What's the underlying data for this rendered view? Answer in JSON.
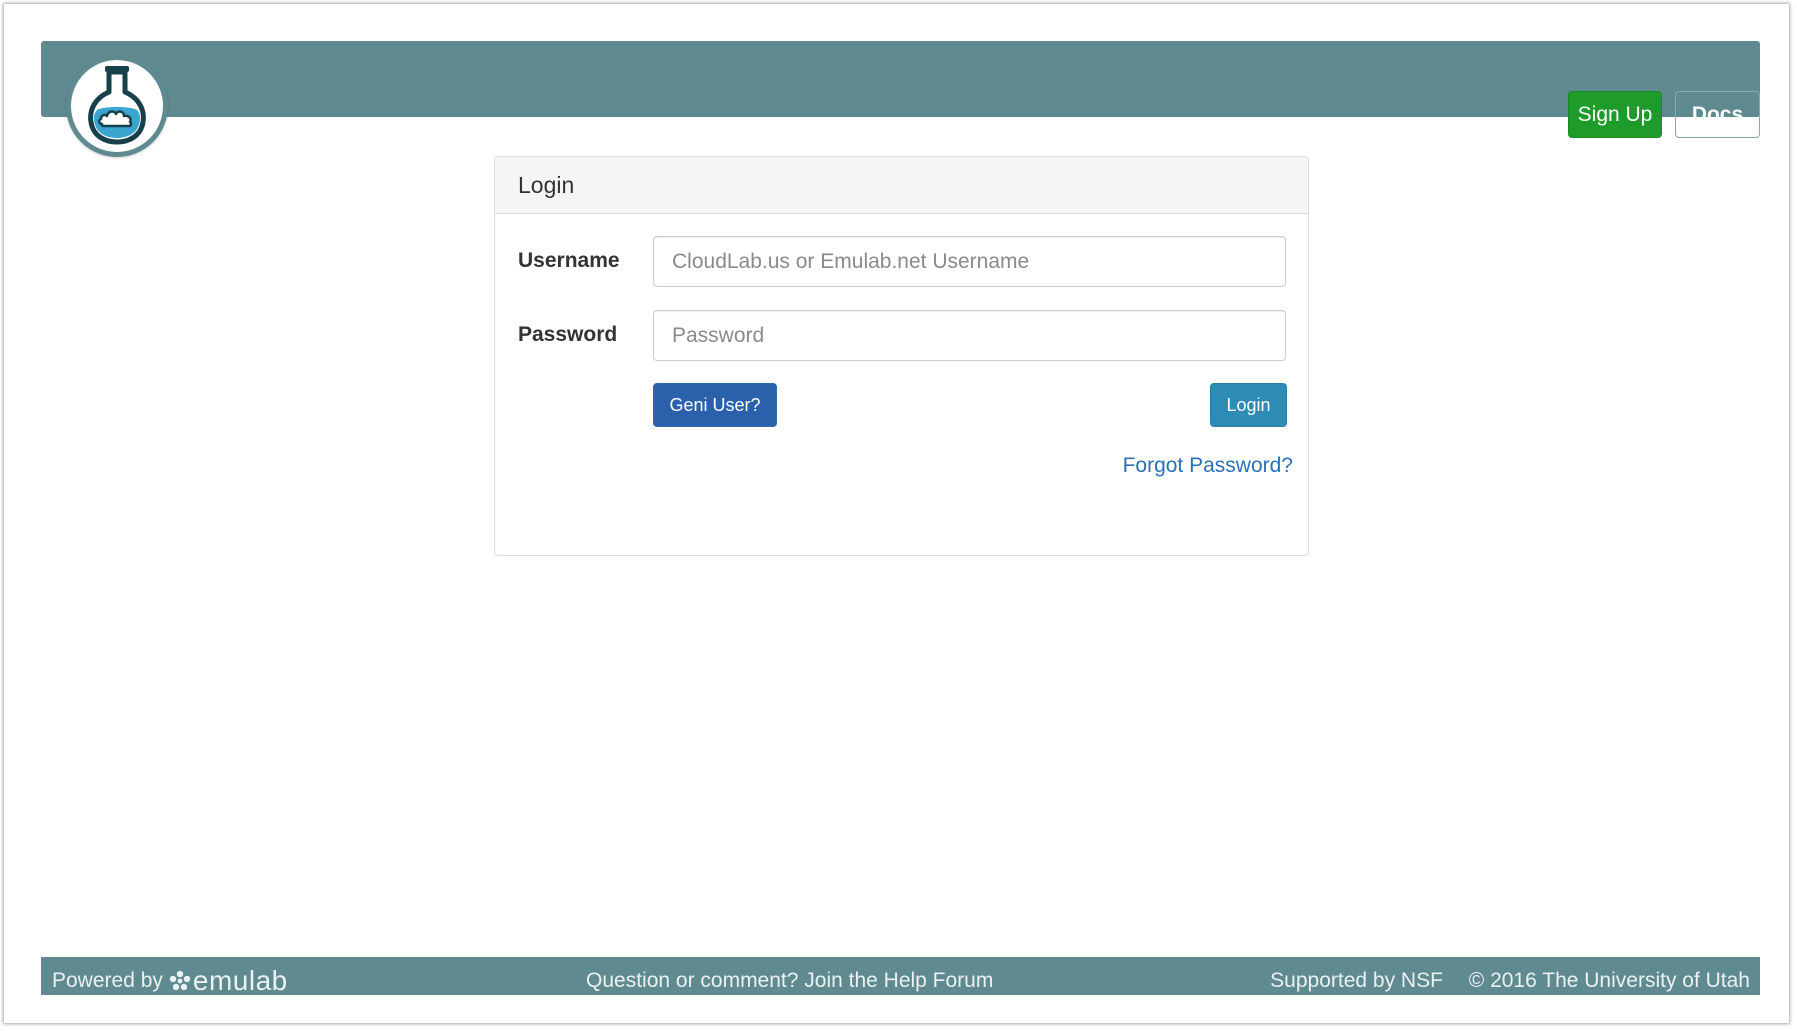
{
  "header": {
    "signup_label": "Sign Up",
    "docs_label": "Docs",
    "colors": {
      "bar": "#5f8a8f",
      "signup": "#1f9b2c"
    }
  },
  "logo": {
    "icon": "flask-cloud-icon"
  },
  "login_panel": {
    "title": "Login",
    "username_label": "Username",
    "username_placeholder": "CloudLab.us or Emulab.net Username",
    "username_value": "",
    "password_label": "Password",
    "password_placeholder": "Password",
    "password_value": "",
    "geni_button_label": "Geni User?",
    "login_button_label": "Login",
    "forgot_password_label": "Forgot Password?"
  },
  "footer": {
    "powered_by": "Powered by",
    "emulab_logo_text": "emulab",
    "help_text": "Question or comment? Join the Help Forum",
    "supported_by": "Supported by NSF",
    "copyright": "© 2016 The University of Utah"
  }
}
